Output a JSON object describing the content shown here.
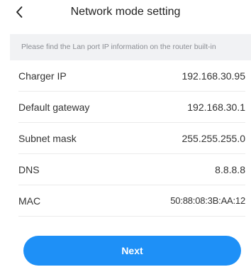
{
  "header": {
    "title": "Network mode setting",
    "back_icon": "chevron-left-icon"
  },
  "notice": {
    "text": "Please find the Lan port IP information on the router built-in"
  },
  "rows": [
    {
      "label": "Charger IP",
      "value": "192.168.30.95"
    },
    {
      "label": "Default gateway",
      "value": "192.168.30.1"
    },
    {
      "label": "Subnet mask",
      "value": "255.255.255.0"
    },
    {
      "label": "DNS",
      "value": "8.8.8.8"
    },
    {
      "label": "MAC",
      "value": "50:88:08:3B:AA:12"
    }
  ],
  "actions": {
    "next_label": "Next"
  },
  "colors": {
    "accent": "#1e90f7",
    "notice_bg": "#f1f2f4",
    "notice_text": "#8a8d93",
    "text": "#333333"
  }
}
